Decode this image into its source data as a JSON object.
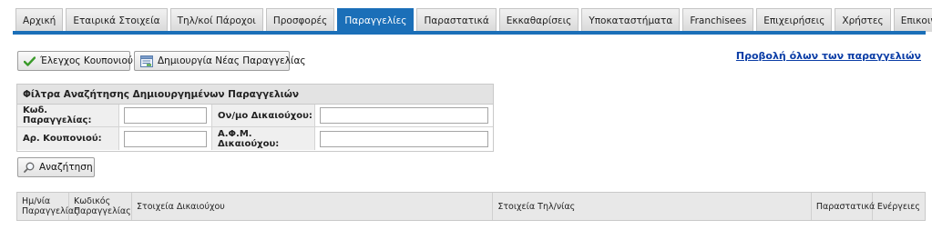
{
  "nav": {
    "tabs": [
      {
        "label": "Αρχική",
        "active": false
      },
      {
        "label": "Εταιρικά Στοιχεία",
        "active": false
      },
      {
        "label": "Τηλ/κοί Πάροχοι",
        "active": false
      },
      {
        "label": "Προσφορές",
        "active": false
      },
      {
        "label": "Παραγγελίες",
        "active": true
      },
      {
        "label": "Παραστατικά",
        "active": false
      },
      {
        "label": "Εκκαθαρίσεις",
        "active": false
      },
      {
        "label": "Υποκαταστήματα",
        "active": false
      },
      {
        "label": "Franchisees",
        "active": false
      },
      {
        "label": "Επιχειρήσεις",
        "active": false
      },
      {
        "label": "Χρήστες",
        "active": false
      },
      {
        "label": "Επικοινωνία",
        "active": false
      }
    ],
    "accent_color": "#1b6fb8"
  },
  "toolbar": {
    "coupon_check_label": "Έλεγχος Κουπονιού",
    "coupon_check_icon": "checkmark-icon",
    "new_order_label": "Δημιουργία Νέας Παραγγελίας",
    "new_order_icon": "form-icon",
    "view_all_link": "Προβολή όλων των παραγγελιών"
  },
  "filters": {
    "title": "Φίλτρα Αναζήτησης Δημιουργημένων Παραγγελιών",
    "order_code_label": "Κωδ. Παραγγελίας:",
    "order_code_value": "",
    "owner_name_label": "Ον/μο Δικαιούχου:",
    "owner_name_value": "",
    "coupon_number_label": "Αρ. Κουπονιού:",
    "coupon_number_value": "",
    "owner_vat_label": "Α.Φ.Μ. Δικαιούχου:",
    "owner_vat_value": "",
    "search_label": "Αναζήτηση",
    "search_icon": "magnifier-icon"
  },
  "results": {
    "columns": {
      "date_line1": "Ημ/νία",
      "date_line2": "Παραγγελίας",
      "code_line1": "Κωδικός",
      "code_line2": "Παραγγελίας",
      "owner": "Στοιχεία Δικαιούχου",
      "shop": "Στοιχεία Τηλ/νίας",
      "documents": "Παραστατικά",
      "actions": "Ενέργειες"
    },
    "rows": []
  }
}
